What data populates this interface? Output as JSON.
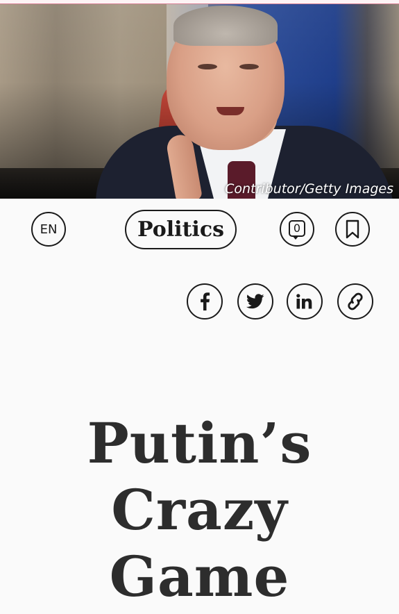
{
  "hero": {
    "credit": "Contributor/Getty Images"
  },
  "toolbar": {
    "language_label": "EN",
    "tag_label": "Politics",
    "comment_count": "0"
  },
  "share": {
    "icons": [
      "facebook-icon",
      "twitter-icon",
      "linkedin-icon",
      "link-icon"
    ]
  },
  "article": {
    "headline_lines": [
      "Putin’s",
      "Crazy",
      "Game"
    ]
  },
  "colors": {
    "ink": "#1a1a1a",
    "headline": "#2d2d2d",
    "background": "#fafafa",
    "top_accent": "#d97f93"
  }
}
